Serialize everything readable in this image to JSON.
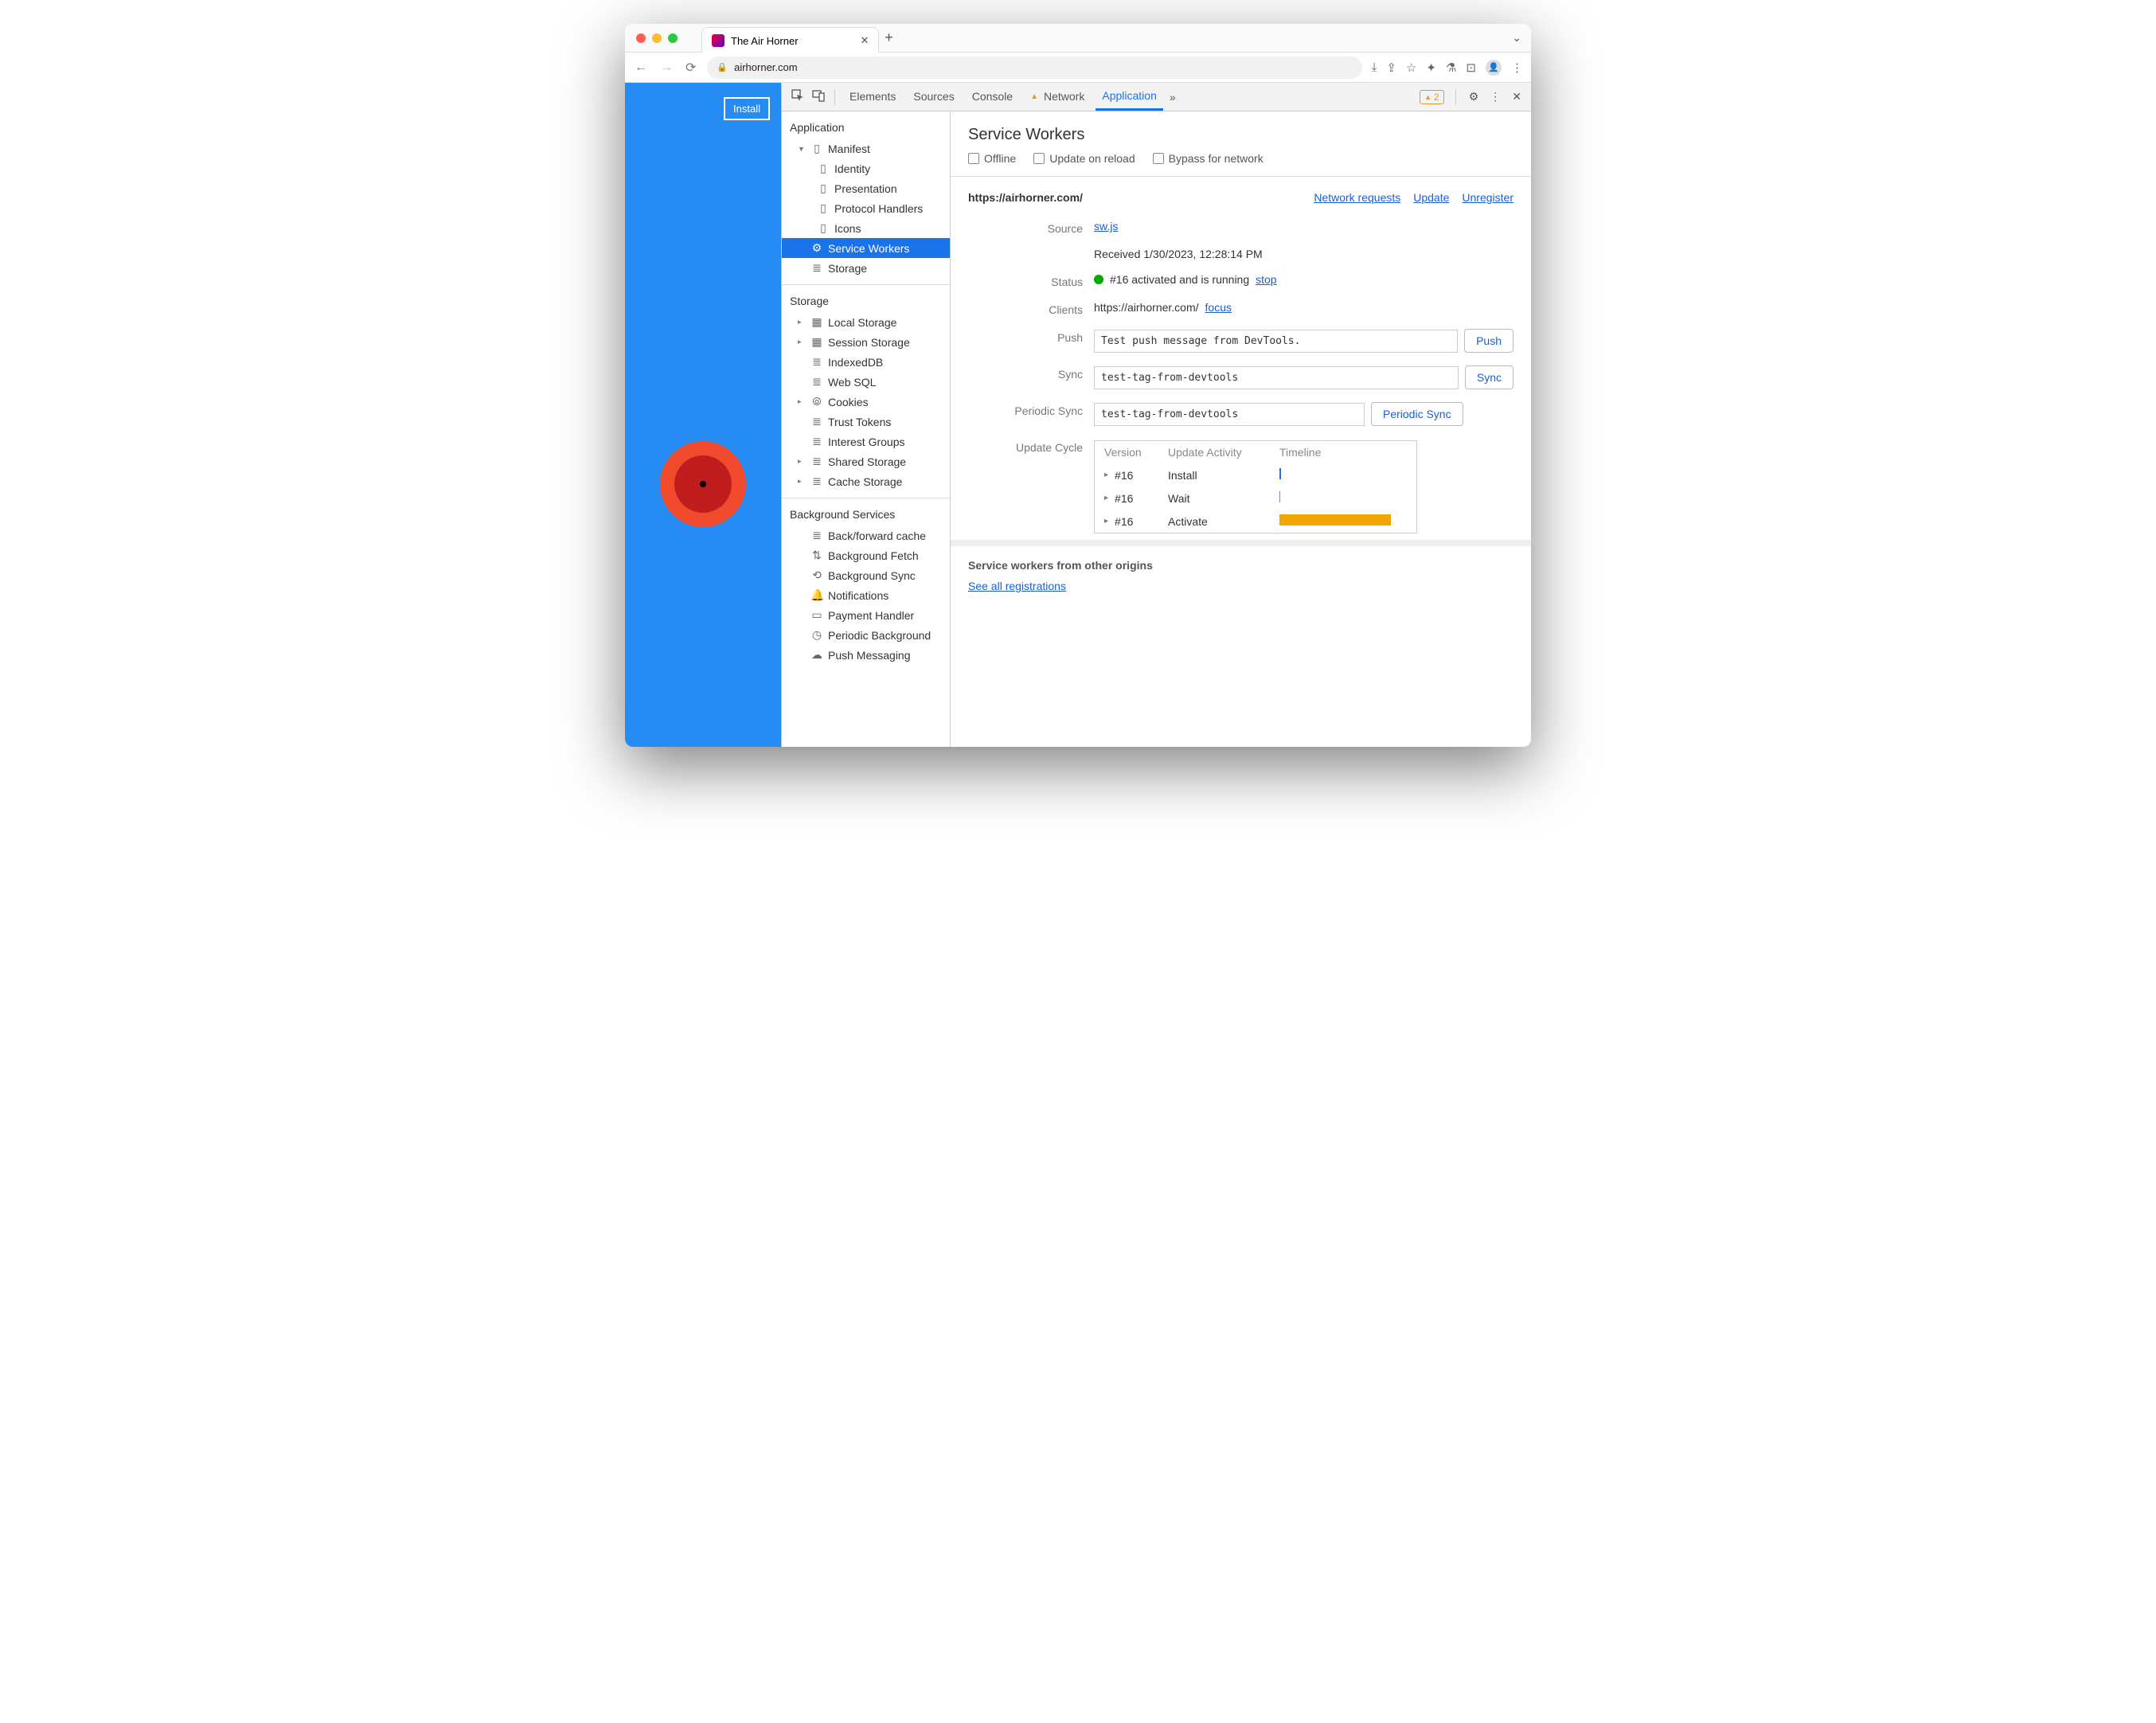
{
  "tab": {
    "title": "The Air Horner"
  },
  "url": {
    "domain": "airhorner.com"
  },
  "page": {
    "install": "Install"
  },
  "devtools": {
    "tabs": {
      "elements": "Elements",
      "sources": "Sources",
      "console": "Console",
      "network": "Network",
      "application": "Application"
    },
    "warnCount": "2",
    "sidebar": {
      "application": "Application",
      "manifest": "Manifest",
      "identity": "Identity",
      "presentation": "Presentation",
      "protocol": "Protocol Handlers",
      "icons": "Icons",
      "serviceWorkers": "Service Workers",
      "storageItem": "Storage",
      "storage": "Storage",
      "localStorage": "Local Storage",
      "sessionStorage": "Session Storage",
      "indexeddb": "IndexedDB",
      "websql": "Web SQL",
      "cookies": "Cookies",
      "trustTokens": "Trust Tokens",
      "interestGroups": "Interest Groups",
      "sharedStorage": "Shared Storage",
      "cacheStorage": "Cache Storage",
      "background": "Background Services",
      "bfcache": "Back/forward cache",
      "bgFetch": "Background Fetch",
      "bgSync": "Background Sync",
      "notifications": "Notifications",
      "payment": "Payment Handler",
      "periodicBg": "Periodic Background",
      "pushMsg": "Push Messaging"
    },
    "sw": {
      "title": "Service Workers",
      "offline": "Offline",
      "updateReload": "Update on reload",
      "bypass": "Bypass for network",
      "scope": "https://airhorner.com/",
      "links": {
        "network": "Network requests",
        "update": "Update",
        "unregister": "Unregister"
      },
      "source": {
        "label": "Source",
        "file": "sw.js",
        "received": "Received 1/30/2023, 12:28:14 PM"
      },
      "status": {
        "label": "Status",
        "text": "#16 activated and is running",
        "stop": "stop"
      },
      "clients": {
        "label": "Clients",
        "url": "https://airhorner.com/",
        "focus": "focus"
      },
      "push": {
        "label": "Push",
        "value": "Test push message from DevTools.",
        "btn": "Push"
      },
      "sync": {
        "label": "Sync",
        "value": "test-tag-from-devtools",
        "btn": "Sync"
      },
      "periodic": {
        "label": "Periodic Sync",
        "value": "test-tag-from-devtools",
        "btn": "Periodic Sync"
      },
      "cycle": {
        "label": "Update Cycle",
        "headers": {
          "version": "Version",
          "activity": "Update Activity",
          "timeline": "Timeline"
        },
        "rows": [
          {
            "version": "#16",
            "activity": "Install"
          },
          {
            "version": "#16",
            "activity": "Wait"
          },
          {
            "version": "#16",
            "activity": "Activate"
          }
        ]
      },
      "other": {
        "title": "Service workers from other origins",
        "link": "See all registrations"
      }
    }
  }
}
